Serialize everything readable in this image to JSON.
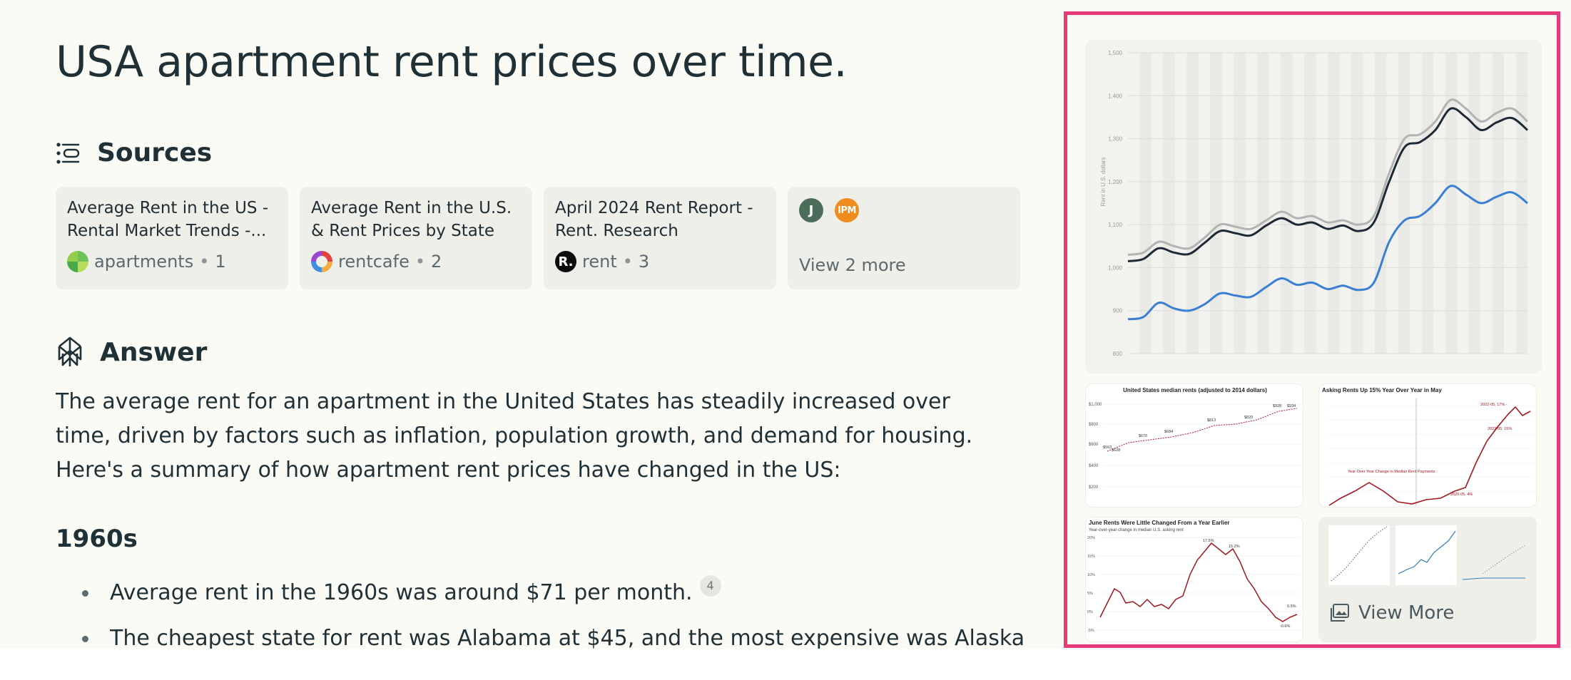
{
  "page": {
    "title": "USA apartment rent prices over time."
  },
  "sources": {
    "heading": "Sources",
    "cards": [
      {
        "title": "Average Rent in the US - Rental Market Trends -...",
        "site": "apartments",
        "index": "1"
      },
      {
        "title": "Average Rent in the U.S. & Rent Prices by State -...",
        "site": "rentcafe",
        "index": "2"
      },
      {
        "title": "April 2024 Rent Report - Rent. Research",
        "site": "rent",
        "index": "3",
        "favicon_letter": "R."
      }
    ],
    "more": {
      "avatar_1": "J",
      "avatar_2": "IPM",
      "label": "View 2 more"
    }
  },
  "answer": {
    "heading": "Answer",
    "intro": "The average rent for an apartment in the United States has steadily increased over time, driven by factors such as inflation, population growth, and demand for housing. Here's a summary of how apartment rent prices have changed in the US:",
    "section_1960s": {
      "title": "1960s",
      "bullets": [
        {
          "text": "Average rent in the 1960s was around $71 per month.",
          "cite": "4"
        },
        {
          "text": "The cheapest state for rent was Alabama at $45, and the most expensive was Alaska",
          "cite": ""
        }
      ]
    }
  },
  "media": {
    "view_more_label": "View More",
    "main_chart": {
      "ylabel": "Rent in U.S. dollars",
      "y_ticks": [
        "800",
        "900",
        "1,000",
        "1,100",
        "1,200",
        "1,300",
        "1,400",
        "1,500"
      ],
      "ylim": [
        800,
        1500
      ]
    },
    "thumb_1": {
      "title": "United States median rents (adjusted to 2014 dollars)",
      "y_ticks": [
        "$1,000",
        "$800",
        "$600",
        "$400",
        "$200"
      ],
      "labels": [
        "$628",
        "$670",
        "$684",
        "$813",
        "$820",
        "$928",
        "$934",
        "$563"
      ]
    },
    "thumb_2": {
      "title": "Asking Rents Up 15% Year Over Year in May",
      "annotations": [
        "2022-05, 17% -",
        "2022-05, 15%",
        "Year Over Year Change in Median Rent Payments",
        "2020-05, 4%"
      ]
    },
    "thumb_3": {
      "title": "June Rents Were Little Changed From a Year Earlier",
      "subtitle": "Year-over-year change in median U.S. asking rent",
      "y_ticks": [
        "20%",
        "15%",
        "10%",
        "5%",
        "0%",
        "-5%"
      ],
      "annotations": [
        "17.5%",
        "15.2%",
        "0.5%",
        "-0.6%"
      ]
    }
  },
  "chart_data": {
    "type": "line",
    "title": "",
    "xlabel": "",
    "ylabel": "Rent in U.S. dollars",
    "ylim": [
      800,
      1500
    ],
    "grid": true,
    "series": [
      {
        "values": [
          1030,
          1035,
          1060,
          1050,
          1045,
          1070,
          1100,
          1095,
          1090,
          1110,
          1130,
          1115,
          1120,
          1105,
          1110,
          1100,
          1120,
          1220,
          1300,
          1310,
          1340,
          1390,
          1370,
          1340,
          1360,
          1370,
          1340
        ]
      },
      {
        "values": [
          1015,
          1020,
          1045,
          1035,
          1032,
          1058,
          1085,
          1080,
          1075,
          1098,
          1115,
          1100,
          1105,
          1090,
          1098,
          1085,
          1105,
          1200,
          1280,
          1292,
          1320,
          1370,
          1350,
          1320,
          1338,
          1348,
          1320
        ]
      },
      {
        "values": [
          880,
          885,
          918,
          905,
          900,
          915,
          940,
          935,
          932,
          955,
          975,
          960,
          965,
          950,
          958,
          948,
          965,
          1060,
          1110,
          1120,
          1150,
          1190,
          1170,
          1150,
          1165,
          1175,
          1150
        ]
      }
    ]
  }
}
